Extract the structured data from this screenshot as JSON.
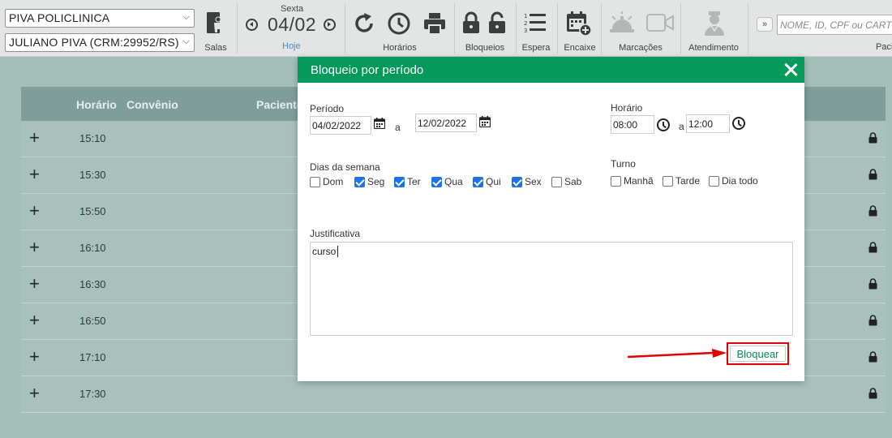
{
  "toolbar": {
    "clinic_select": "PIVA POLICLINICA",
    "doctor_select": "JULIANO PIVA (CRM:29952/RS)",
    "salas_label": "Salas",
    "weekday": "Sexta",
    "date": "04/02",
    "today_label": "Hoje",
    "horarios_label": "Horários",
    "bloqueios_label": "Bloqueios",
    "espera_label": "Espera",
    "encaixe_label": "Encaixe",
    "marcacoes_label": "Marcações",
    "atendimento_label": "Atendimento",
    "expand_label": "»",
    "search_placeholder": "NOME, ID, CPF ou CARTEIRA",
    "pacientes_label": "Paci"
  },
  "table": {
    "columns": [
      "Horário",
      "Convênio",
      "Paciente"
    ],
    "rows": [
      {
        "time": "15:10"
      },
      {
        "time": "15:30"
      },
      {
        "time": "15:50"
      },
      {
        "time": "16:10"
      },
      {
        "time": "16:30"
      },
      {
        "time": "16:50"
      },
      {
        "time": "17:10"
      },
      {
        "time": "17:30"
      }
    ]
  },
  "modal": {
    "title": "Bloqueio por período",
    "periodo_label": "Período",
    "date_from": "04/02/2022",
    "date_to": "12/02/2022",
    "a_label": "a",
    "horario_label": "Horário",
    "time_from": "08:00",
    "time_to": "12:00",
    "dias_label": "Dias da semana",
    "days": [
      {
        "label": "Dom",
        "checked": false
      },
      {
        "label": "Seg",
        "checked": true
      },
      {
        "label": "Ter",
        "checked": true
      },
      {
        "label": "Qua",
        "checked": true
      },
      {
        "label": "Qui",
        "checked": true
      },
      {
        "label": "Sex",
        "checked": true
      },
      {
        "label": "Sab",
        "checked": false
      }
    ],
    "turno_label": "Turno",
    "turnos": [
      {
        "label": "Manhã",
        "checked": false
      },
      {
        "label": "Tarde",
        "checked": false
      },
      {
        "label": "Dia todo",
        "checked": false
      }
    ],
    "justificativa_label": "Justificativa",
    "justificativa_value": "curso",
    "submit_label": "Bloquear"
  },
  "colors": {
    "modal_header": "#049a5b",
    "highlight": "#e00000",
    "checkbox_checked": "#1a73e8",
    "table_header": "#7f9e9a",
    "overlay": "#a4bfba"
  }
}
